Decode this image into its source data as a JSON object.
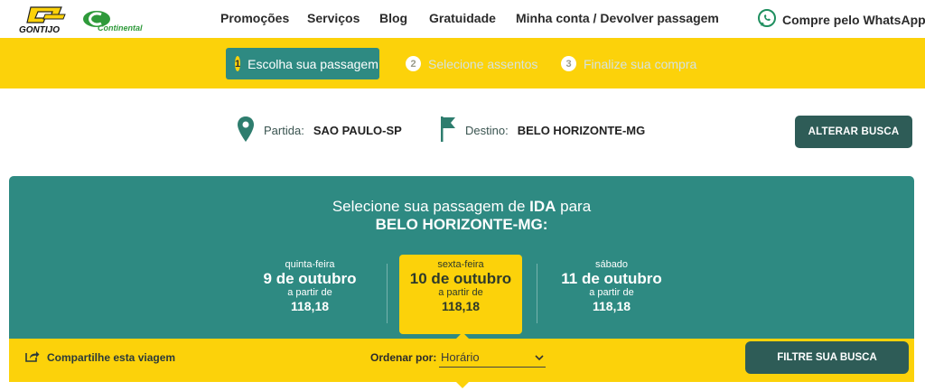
{
  "header": {
    "logo1_text": "GONTIJO",
    "logo2_text": "Continental",
    "nav": [
      "Promoções",
      "Serviços",
      "Blog",
      "Gratuidade",
      "Minha conta / Devolver passagem"
    ],
    "whatsapp_label": "Compre pelo WhatsApp"
  },
  "steps": [
    {
      "num": "1",
      "label": "Escolha sua passagem",
      "active": true
    },
    {
      "num": "2",
      "label": "Selecione assentos",
      "active": false
    },
    {
      "num": "3",
      "label": "Finalize sua compra",
      "active": false
    }
  ],
  "route": {
    "origin_label": "Partida:",
    "origin_value": "SAO PAULO-SP",
    "dest_label": "Destino:",
    "dest_value": "BELO HORIZONTE-MG",
    "change_button": "ALTERAR BUSCA"
  },
  "selection": {
    "title_prefix": "Selecione sua passagem de ",
    "title_bold": "IDA",
    "title_suffix": " para",
    "destination": "BELO HORIZONTE-MG:"
  },
  "days": [
    {
      "weekday": "quinta-feira",
      "date": "9 de outubro",
      "from_label": "a partir de",
      "price": "118,18",
      "selected": false
    },
    {
      "weekday": "sexta-feira",
      "date": "10 de outubro",
      "from_label": "a partir de",
      "price": "118,18",
      "selected": true
    },
    {
      "weekday": "sábado",
      "date": "11 de outubro",
      "from_label": "a partir de",
      "price": "118,18",
      "selected": false
    }
  ],
  "toolbar": {
    "share_label": "Compartilhe esta viagem",
    "order_label": "Ordenar por:",
    "order_value": "Horário",
    "filter_button": "FILTRE SUA BUSCA"
  },
  "colors": {
    "teal": "#2e8a82",
    "dark_teal": "#2e5c57",
    "yellow": "#fcd20a",
    "whatsapp": "#25d366"
  }
}
